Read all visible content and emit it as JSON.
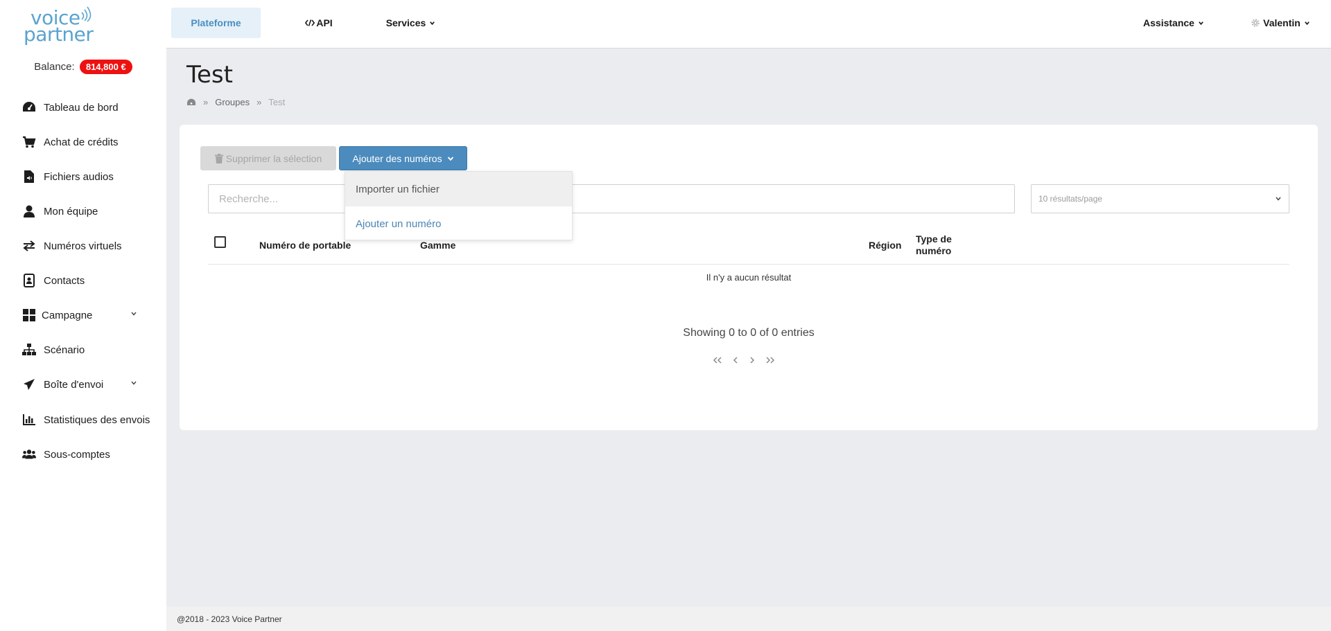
{
  "brand": {
    "logo_line1": "voice",
    "logo_line2": "partner"
  },
  "balance": {
    "label": "Balance:",
    "value": "814,800 €"
  },
  "sidebar": {
    "items": [
      {
        "label": "Tableau de bord",
        "icon": "dashboard-icon"
      },
      {
        "label": "Achat de crédits",
        "icon": "cart-icon"
      },
      {
        "label": "Fichiers audios",
        "icon": "audio-file-icon"
      },
      {
        "label": "Mon équipe",
        "icon": "user-icon"
      },
      {
        "label": "Numéros virtuels",
        "icon": "exchange-icon"
      },
      {
        "label": "Contacts",
        "icon": "contact-card-icon"
      },
      {
        "label": "Campagne",
        "icon": "grid-icon",
        "expandable": true
      },
      {
        "label": "Scénario",
        "icon": "sitemap-icon"
      },
      {
        "label": "Boîte d'envoi",
        "icon": "paper-plane-icon",
        "expandable": true
      },
      {
        "label": "Statistiques des envois",
        "icon": "bar-chart-icon"
      },
      {
        "label": "Sous-comptes",
        "icon": "users-icon"
      }
    ]
  },
  "topbar": {
    "tabs": [
      {
        "label": "Plateforme",
        "active": true
      },
      {
        "label": "API",
        "icon": "code-icon"
      },
      {
        "label": "Services",
        "dropdown": true
      }
    ],
    "right": [
      {
        "label": "Assistance",
        "dropdown": true
      },
      {
        "label": "Valentin",
        "icon": "gear-icon",
        "dropdown": true
      }
    ]
  },
  "page": {
    "title": "Test",
    "breadcrumb": {
      "sep": "»",
      "items": [
        "Groupes",
        "Test"
      ]
    }
  },
  "toolbar": {
    "delete_label": "Supprimer la sélection",
    "add_label": "Ajouter des numéros"
  },
  "dropdown": {
    "items": [
      "Importer un fichier",
      "Ajouter un numéro"
    ]
  },
  "search": {
    "placeholder": "Recherche..."
  },
  "perpage": {
    "selected": "10 résultats/page"
  },
  "table": {
    "columns": [
      "Numéro de portable",
      "Gamme",
      "Région",
      "Type de numéro"
    ],
    "col4_line1": "Type de",
    "col4_line2": "numéro",
    "empty": "Il n'y a aucun résultat"
  },
  "pagination": {
    "info": "Showing 0 to 0 of 0 entries"
  },
  "footer": {
    "text": "@2018 - 2023 Voice Partner"
  },
  "colors": {
    "accent": "#4b8bbd",
    "badge": "#ee1111",
    "active_tab_bg": "#e5f0f8"
  }
}
